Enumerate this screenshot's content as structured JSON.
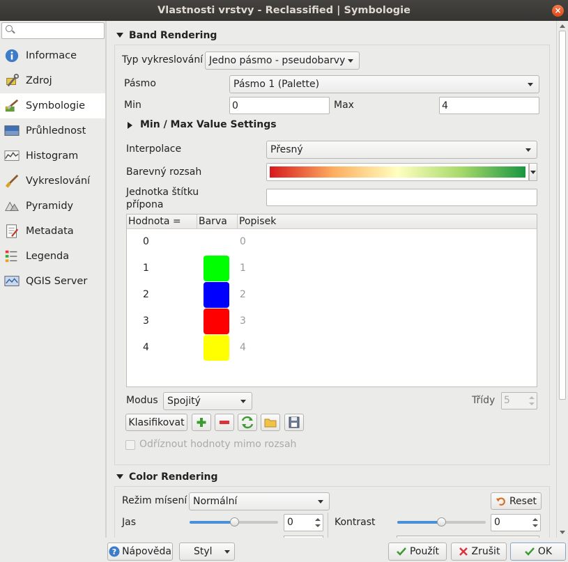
{
  "window": {
    "title": "Vlastnosti vrstvy - Reclassified | Symbologie",
    "close_glyph": "×"
  },
  "sidebar": {
    "search_placeholder": "",
    "items": [
      {
        "label": "Informace",
        "icon": "info-icon"
      },
      {
        "label": "Zdroj",
        "icon": "source-wrench-icon"
      },
      {
        "label": "Symbologie",
        "icon": "symbology-brush-icon",
        "active": true
      },
      {
        "label": "Průhlednost",
        "icon": "transparency-icon"
      },
      {
        "label": "Histogram",
        "icon": "histogram-icon"
      },
      {
        "label": "Vykreslování",
        "icon": "rendering-brush-icon"
      },
      {
        "label": "Pyramidy",
        "icon": "pyramids-icon"
      },
      {
        "label": "Metadata",
        "icon": "metadata-icon"
      },
      {
        "label": "Legenda",
        "icon": "legend-icon"
      },
      {
        "label": "QGIS Server",
        "icon": "qgis-server-icon"
      }
    ]
  },
  "band_rendering": {
    "title": "Band Rendering",
    "render_type_label": "Typ vykreslování",
    "render_type_value": "Jedno pásmo - pseudobarvy",
    "band_label": "Pásmo",
    "band_value": "Pásmo 1 (Palette)",
    "min_label": "Min",
    "min_value": "0",
    "max_label": "Max",
    "max_value": "4",
    "minmax_settings_title": "Min / Max Value Settings",
    "interpolation_label": "Interpolace",
    "interpolation_value": "Přesný",
    "color_ramp_label": "Barevný rozsah",
    "color_ramp_colors": [
      "#d7191c",
      "#fdae61",
      "#ffffbf",
      "#a6d96a",
      "#1a9641"
    ],
    "unit_suffix_label": "Jednotka štítku\npřípona",
    "unit_suffix_value": "",
    "table": {
      "headers": [
        "Hodnota =",
        "Barva",
        "Popisek"
      ],
      "rows": [
        {
          "value": "0",
          "color": null,
          "label": "0"
        },
        {
          "value": "1",
          "color": "#00ff00",
          "label": "1"
        },
        {
          "value": "2",
          "color": "#0000ff",
          "label": "2"
        },
        {
          "value": "3",
          "color": "#ff0000",
          "label": "3"
        },
        {
          "value": "4",
          "color": "#ffff00",
          "label": "4"
        }
      ]
    },
    "mode_label": "Modus",
    "mode_value": "Spojitý",
    "classes_label": "Třídy",
    "classes_value": "5",
    "classify_button": "Klasifikovat",
    "clip_checkbox_label": "Odříznout hodnoty mimo rozsah",
    "clip_checked": false
  },
  "color_rendering": {
    "title": "Color Rendering",
    "blend_label": "Režim mísení",
    "blend_value": "Normální",
    "reset_button": "Reset",
    "brightness_label": "Jas",
    "brightness_value": "0",
    "contrast_label": "Kontrast",
    "contrast_value": "0"
  },
  "buttons": {
    "help": "Nápověda",
    "style": "Styl",
    "apply": "Použít",
    "cancel": "Zrušit",
    "ok": "OK"
  }
}
